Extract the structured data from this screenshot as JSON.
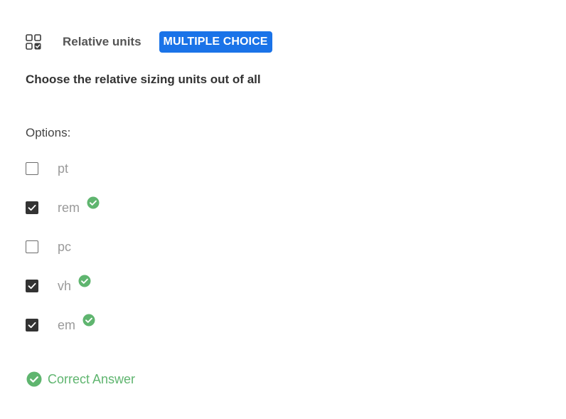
{
  "header": {
    "type_icon": "grid-check-icon",
    "topic": "Relative units",
    "badge": "MULTIPLE CHOICE",
    "badge_color": "#1a73e8"
  },
  "question": {
    "text": "Choose the relative sizing units out of all"
  },
  "options_label": "Options:",
  "options": [
    {
      "label": "pt",
      "checked": false,
      "correct": false
    },
    {
      "label": "rem",
      "checked": true,
      "correct": true
    },
    {
      "label": "pc",
      "checked": false,
      "correct": false
    },
    {
      "label": "vh",
      "checked": true,
      "correct": true
    },
    {
      "label": "em",
      "checked": true,
      "correct": true
    }
  ],
  "result": {
    "icon": "check-circle-icon",
    "text": "Correct Answer",
    "color": "#5fb56f"
  }
}
